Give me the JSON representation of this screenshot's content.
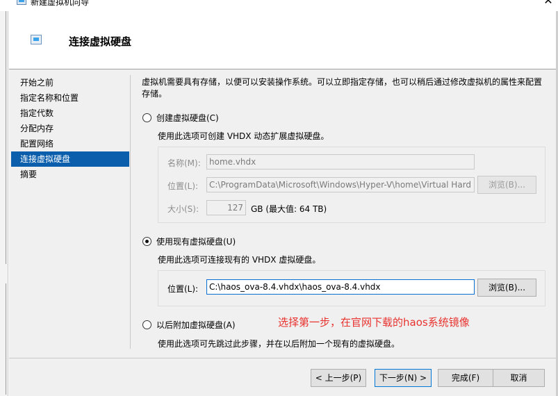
{
  "window": {
    "title": "新建虚拟机向导",
    "close_glyph": "✕"
  },
  "header": {
    "title": "连接虚拟硬盘"
  },
  "nav": {
    "items": [
      {
        "label": "开始之前"
      },
      {
        "label": "指定名称和位置"
      },
      {
        "label": "指定代数"
      },
      {
        "label": "分配内存"
      },
      {
        "label": "配置网络"
      },
      {
        "label": "连接虚拟硬盘",
        "selected": true
      },
      {
        "label": "摘要"
      }
    ]
  },
  "content": {
    "description": "虚拟机需要具有存储，以便可以安装操作系统。可以立即指定存储，也可以稍后通过修改虚拟机的属性来配置存储。",
    "create_option": {
      "label": "创建虚拟硬盘(C)",
      "selected": false,
      "hint": "使用此选项可创建 VHDX 动态扩展虚拟硬盘。",
      "name_label": "名称(M):",
      "name_value": "home.vhdx",
      "location_label": "位置(L):",
      "location_value": "C:\\ProgramData\\Microsoft\\Windows\\Hyper-V\\home\\Virtual Hard",
      "browse_label": "浏览(B)...",
      "size_label": "大小(S):",
      "size_value": "127",
      "size_unit": "GB (最大值: 64 TB)"
    },
    "existing_option": {
      "label": "使用现有虚拟硬盘(U)",
      "selected": true,
      "hint": "使用此选项可连接现有的 VHDX 虚拟硬盘。",
      "location_label": "位置(L):",
      "location_value": "C:\\haos_ova-8.4.vhdx\\haos_ova-8.4.vhdx",
      "browse_label": "浏览(B)..."
    },
    "later_option": {
      "label": "以后附加虚拟硬盘(A)",
      "selected": false,
      "hint": "使用此选项可先跳过此步骤，并在以后附加一个现有的虚拟硬盘。"
    },
    "annotation": "选择第一步，在官网下载的haos系统镜像"
  },
  "footer": {
    "prev_label": "< 上一步(P)",
    "next_label": "下一步(N) >",
    "finish_label": "完成(F)",
    "cancel_label": "取消"
  },
  "colors": {
    "selection": "#0a5eac",
    "annotation": "#e8322e",
    "focus_border": "#0078d7"
  },
  "icons": [
    "vm-icon",
    "close-icon",
    "disk-icon"
  ]
}
